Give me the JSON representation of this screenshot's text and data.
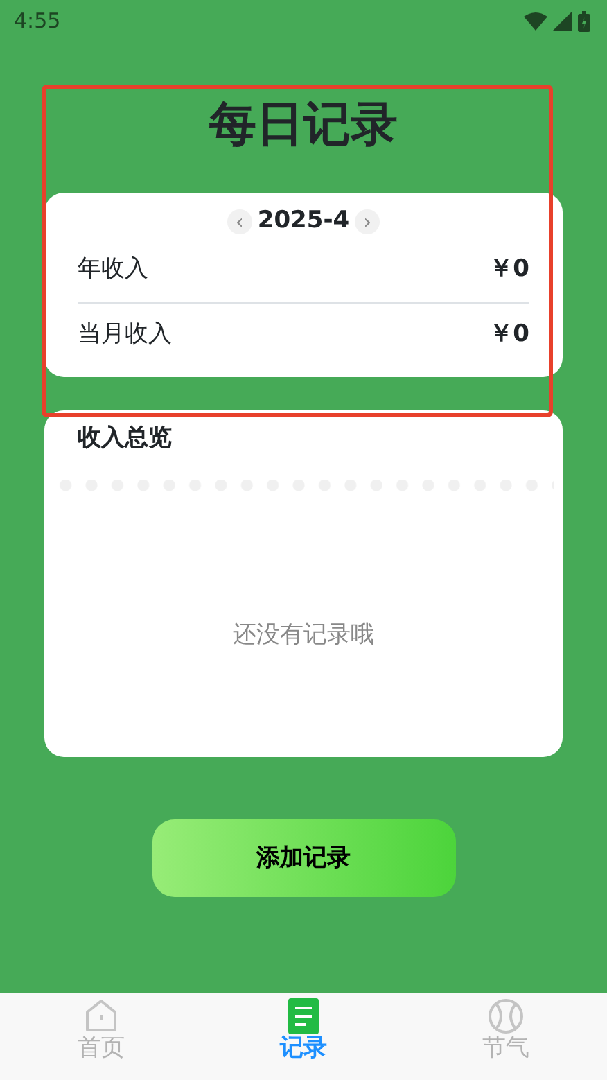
{
  "status_bar": {
    "time": "4:55"
  },
  "title": "每日记录",
  "summary": {
    "month": "2025-4",
    "prev": "‹",
    "next": "›",
    "rows": [
      {
        "label": "年收入",
        "value": "￥0"
      },
      {
        "label": "当月收入",
        "value": "￥0"
      }
    ]
  },
  "overview": {
    "title": "收入总览",
    "empty": "还没有记录哦"
  },
  "add_button": "添加记录",
  "tabs": [
    {
      "label": "首页",
      "kind": "home",
      "selected": false
    },
    {
      "label": "记录",
      "kind": "record",
      "selected": true
    },
    {
      "label": "节气",
      "kind": "ball",
      "selected": false
    }
  ]
}
